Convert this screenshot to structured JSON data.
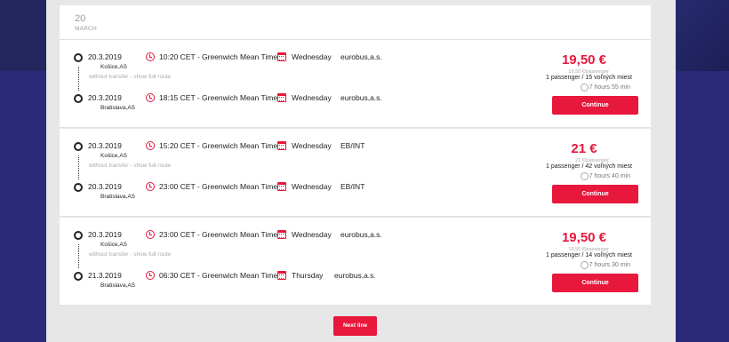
{
  "date_header": {
    "day": "20",
    "month": "MARCH"
  },
  "trips": [
    {
      "departure": {
        "date": "20.3.2019",
        "city": "Košice,AS",
        "time": "10:20 CET - Greenwich Mean Time",
        "weekday": "Wednesday",
        "carrier": "eurobus,a.s."
      },
      "transfer": "without transfer - show full route",
      "arrival": {
        "date": "20.3.2019",
        "city": "Bratislava,AS",
        "time": "18:15 CET - Greenwich Mean Time",
        "weekday": "Wednesday",
        "carrier": "eurobus,a.s."
      },
      "price": "19,50 €",
      "per_passenger": "19,50 €/passenger",
      "seats": "1 passenger / 15 voľných miest",
      "duration": "7 hours 55 min",
      "button": "Continue"
    },
    {
      "departure": {
        "date": "20.3.2019",
        "city": "Košice,AS",
        "time": "15:20 CET - Greenwich Mean Time",
        "weekday": "Wednesday",
        "carrier": "EB/INT"
      },
      "transfer": "without transfer - show full route",
      "arrival": {
        "date": "20.3.2019",
        "city": "Bratislava,AS",
        "time": "23:00 CET - Greenwich Mean Time",
        "weekday": "Wednesday",
        "carrier": "EB/INT"
      },
      "price": "21 €",
      "per_passenger": "21 €/passenger",
      "seats": "1 passenger / 42 voľných miest",
      "duration": "7 hours 40 min",
      "button": "Continue"
    },
    {
      "departure": {
        "date": "20.3.2019",
        "city": "Košice,AS",
        "time": "23:00 CET - Greenwich Mean Time",
        "weekday": "Wednesday",
        "carrier": "eurobus,a.s."
      },
      "transfer": "without transfer - show full route",
      "arrival": {
        "date": "21.3.2019",
        "city": "Bratislava,AS",
        "time": "06:30 CET - Greenwich Mean Time",
        "weekday": "Thursday",
        "carrier": "eurobus,a.s."
      },
      "price": "19,50 €",
      "per_passenger": "19,50 €/passenger",
      "seats": "1 passenger / 14 voľných miest",
      "duration": "7 hours 30 min",
      "button": "Continue"
    }
  ],
  "next_button": "Next line",
  "colors": {
    "accent": "#e8173c",
    "background": "#2a2a78",
    "panel": "#e7e7e7"
  }
}
